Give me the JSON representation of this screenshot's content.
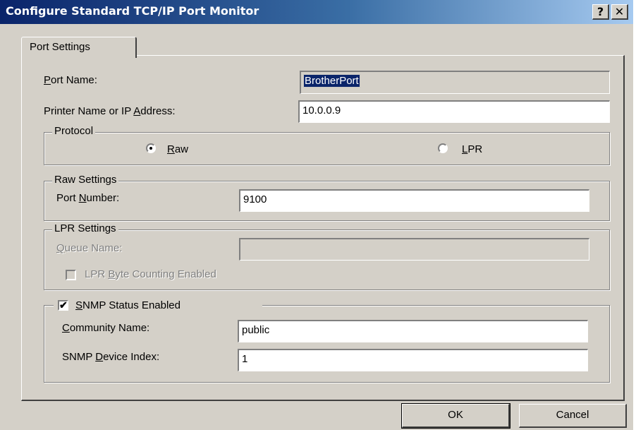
{
  "window": {
    "title": "Configure Standard TCP/IP Port Monitor",
    "help_glyph": "?",
    "close_glyph": "✕"
  },
  "tabs": [
    {
      "label": "Port Settings",
      "selected": true
    }
  ],
  "port_name": {
    "label_accel": "P",
    "label_rest": "ort Name:",
    "value": "BrotherPort"
  },
  "printer_address": {
    "label_pre": "Printer Name or IP ",
    "label_accel": "A",
    "label_post": "ddress:",
    "value": "10.0.0.9"
  },
  "protocol": {
    "group_label": "Protocol",
    "options": [
      {
        "accel": "R",
        "rest": "aw",
        "selected": true
      },
      {
        "accel": "L",
        "rest": "PR",
        "selected": false
      }
    ]
  },
  "raw_settings": {
    "group_label": "Raw Settings",
    "port_number": {
      "label_pre": "Port ",
      "label_accel": "N",
      "label_post": "umber:",
      "value": "9100"
    }
  },
  "lpr_settings": {
    "group_label": "LPR Settings",
    "queue_name": {
      "label_accel": "Q",
      "label_rest": "ueue Name:",
      "value": ""
    },
    "byte_counting": {
      "label_pre": "LPR ",
      "label_accel": "B",
      "label_post": "yte Counting Enabled",
      "checked": false
    }
  },
  "snmp": {
    "enabled": {
      "label_accel": "S",
      "label_rest": "NMP Status Enabled",
      "checked": true,
      "check_glyph": "✔"
    },
    "community_name": {
      "label_accel": "C",
      "label_rest": "ommunity Name:",
      "value": "public"
    },
    "device_index": {
      "label_pre": "SNMP ",
      "label_accel": "D",
      "label_post": "evice Index:",
      "value": "1"
    }
  },
  "buttons": {
    "ok": "OK",
    "cancel": "Cancel"
  }
}
